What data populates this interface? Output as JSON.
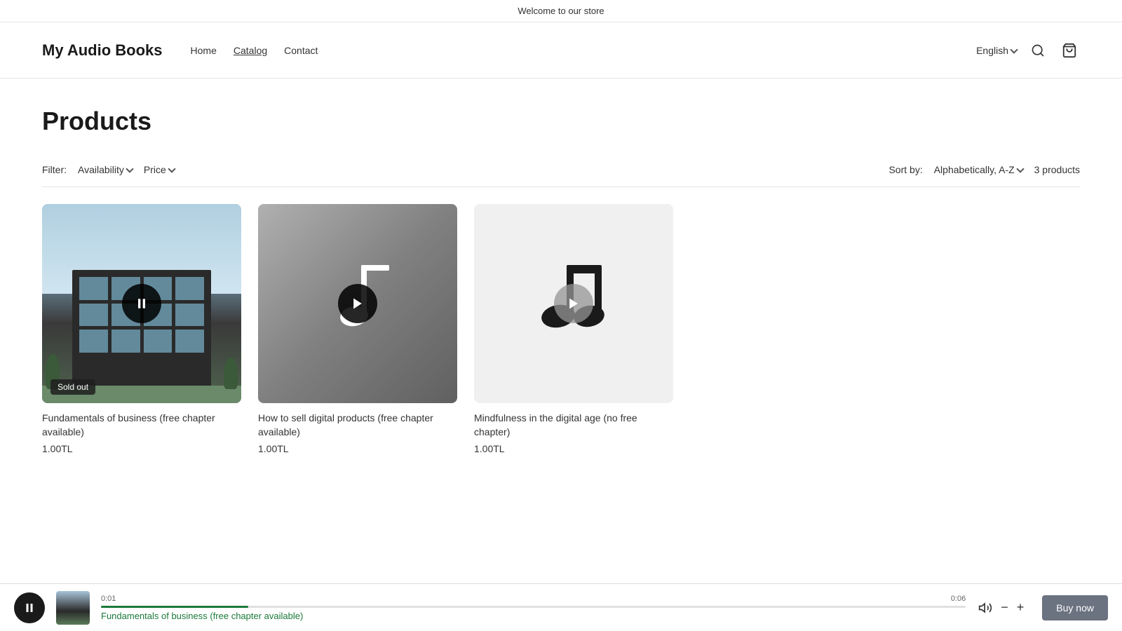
{
  "banner": {
    "text": "Welcome to our store"
  },
  "header": {
    "site_title": "My Audio Books",
    "nav": [
      {
        "label": "Home",
        "active": false
      },
      {
        "label": "Catalog",
        "active": true
      },
      {
        "label": "Contact",
        "active": false
      }
    ],
    "language": "English",
    "lang_chevron": "▾"
  },
  "page": {
    "title": "Products"
  },
  "filter_bar": {
    "filter_label": "Filter:",
    "availability_label": "Availability",
    "price_label": "Price",
    "sort_label": "Sort by:",
    "sort_value": "Alphabetically, A-Z",
    "products_count": "3 products"
  },
  "products": [
    {
      "id": "prod-1",
      "name": "Fundamentals of business (free chapter available)",
      "price": "1.00TL",
      "type": "building",
      "sold_out": true,
      "sold_out_label": "Sold out",
      "playing": true
    },
    {
      "id": "prod-2",
      "name": "How to sell digital products (free chapter available)",
      "price": "1.00TL",
      "type": "music",
      "sold_out": false,
      "playing": false
    },
    {
      "id": "prod-3",
      "name": "Mindfulness in the digital age (no free chapter)",
      "price": "1.00TL",
      "type": "audio-note",
      "sold_out": false,
      "playing": false
    }
  ],
  "player": {
    "current_time": "0:01",
    "total_time": "0:06",
    "progress_percent": 17,
    "track_name": "Fundamentals of business (free chapter available)",
    "buy_now_label": "Buy now"
  }
}
